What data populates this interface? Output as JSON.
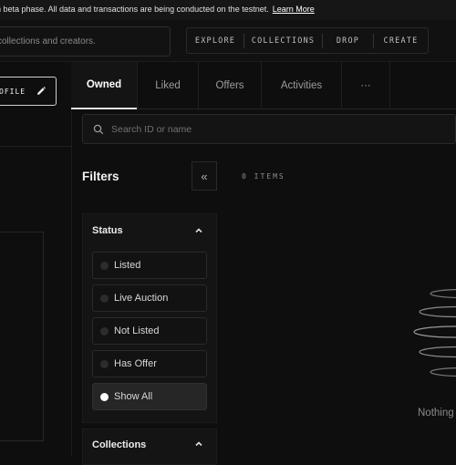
{
  "banner": {
    "text": "n beta phase. All data and transactions are being conducted on the testnet.",
    "link": "Learn More"
  },
  "header": {
    "search_placeholder": "collections and creators.",
    "nav": [
      "EXPLORE",
      "COLLECTIONS",
      "DROP",
      "CREATE"
    ]
  },
  "profile": {
    "edit_label": "OFILE"
  },
  "tabs": [
    {
      "label": "Owned",
      "active": true
    },
    {
      "label": "Liked"
    },
    {
      "label": "Offers"
    },
    {
      "label": "Activities"
    },
    {
      "label": "···"
    }
  ],
  "search": {
    "placeholder": "Search ID or name"
  },
  "filters": {
    "title": "Filters",
    "collapse_icon": "«",
    "items_count": "0 ITEMS",
    "status": {
      "label": "Status",
      "options": [
        {
          "label": "Listed",
          "selected": false
        },
        {
          "label": "Live Auction",
          "selected": false
        },
        {
          "label": "Not Listed",
          "selected": false
        },
        {
          "label": "Has Offer",
          "selected": false
        },
        {
          "label": "Show All",
          "selected": true
        }
      ]
    },
    "collections": {
      "label": "Collections"
    }
  },
  "empty_state": {
    "text": "Nothing"
  },
  "colors": {
    "background": "#0e0e0e",
    "text": "#e6e6e6",
    "muted": "#8a8a8a",
    "border": "#2a2a2a"
  }
}
